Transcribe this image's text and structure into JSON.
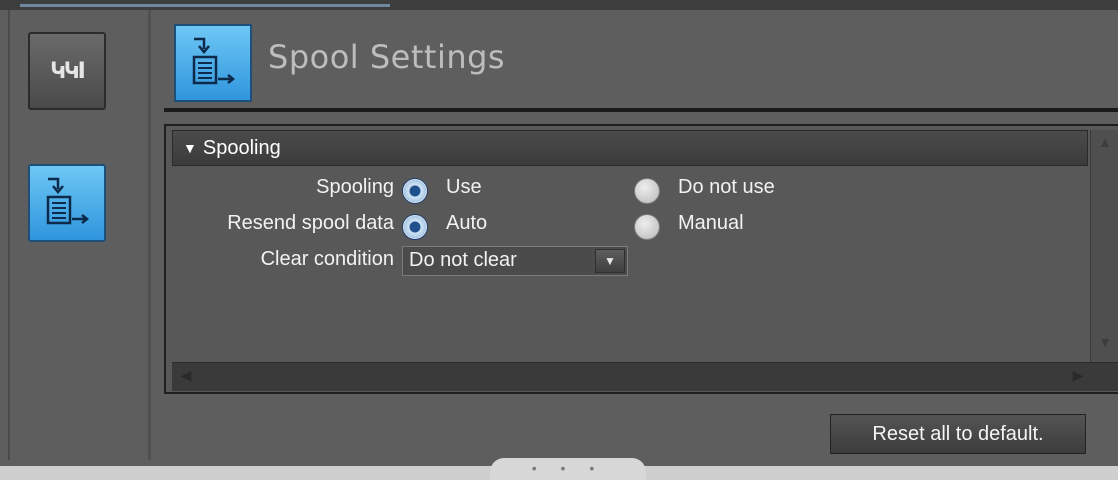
{
  "sidebar": {
    "items": [
      {
        "icon": "ladder-logic-icon",
        "glyph": "ԿԿⅠ"
      },
      {
        "icon": "spool-settings-icon",
        "active": true
      }
    ]
  },
  "header": {
    "icon": "spool-settings-icon",
    "title": "Spool Settings"
  },
  "section": {
    "title": "Spooling",
    "collapse_glyph": "▼"
  },
  "settings": {
    "spooling": {
      "label": "Spooling",
      "options": [
        "Use",
        "Do not use"
      ],
      "selected": "Use"
    },
    "resend": {
      "label": "Resend spool data",
      "options": [
        "Auto",
        "Manual"
      ],
      "selected": "Auto"
    },
    "clear": {
      "label": "Clear condition",
      "value": "Do not clear",
      "dropdown_glyph": "▼"
    }
  },
  "scrollbars": {
    "up": "▲",
    "down": "▼",
    "left": "◀",
    "right": "▶"
  },
  "footer": {
    "reset_label": "Reset all to default.",
    "grip_glyph": "• • •"
  },
  "colors": {
    "accent_blue": "#3aa3e6",
    "radio_selected": "#1f4f8c",
    "background": "#5e5e5e"
  }
}
